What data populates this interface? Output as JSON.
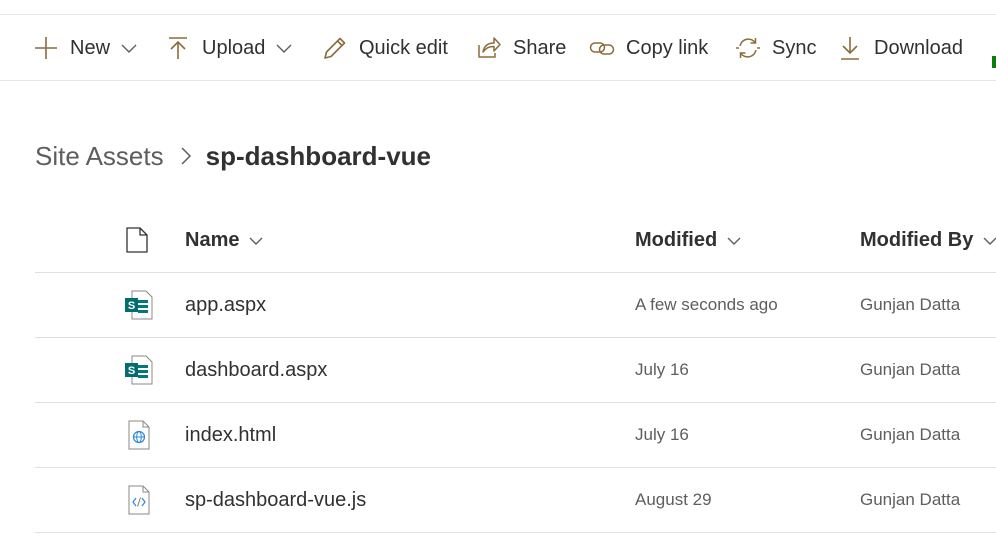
{
  "commandbar": {
    "new_label": "New",
    "upload_label": "Upload",
    "quick_edit_label": "Quick edit",
    "share_label": "Share",
    "copy_link_label": "Copy link",
    "sync_label": "Sync",
    "download_label": "Download",
    "icon_color": "#8a6d3b"
  },
  "breadcrumb": {
    "root": "Site Assets",
    "current": "sp-dashboard-vue"
  },
  "columns": {
    "name": "Name",
    "modified": "Modified",
    "modified_by": "Modified By"
  },
  "files": [
    {
      "name": "app.aspx",
      "modified": "A few seconds ago",
      "modified_by": "Gunjan Datta",
      "type": "sharepoint-page-icon"
    },
    {
      "name": "dashboard.aspx",
      "modified": "July 16",
      "modified_by": "Gunjan Datta",
      "type": "sharepoint-page-icon"
    },
    {
      "name": "index.html",
      "modified": "July 16",
      "modified_by": "Gunjan Datta",
      "type": "html-file-icon"
    },
    {
      "name": "sp-dashboard-vue.js",
      "modified": "August 29",
      "modified_by": "Gunjan Datta",
      "type": "code-file-icon"
    }
  ]
}
